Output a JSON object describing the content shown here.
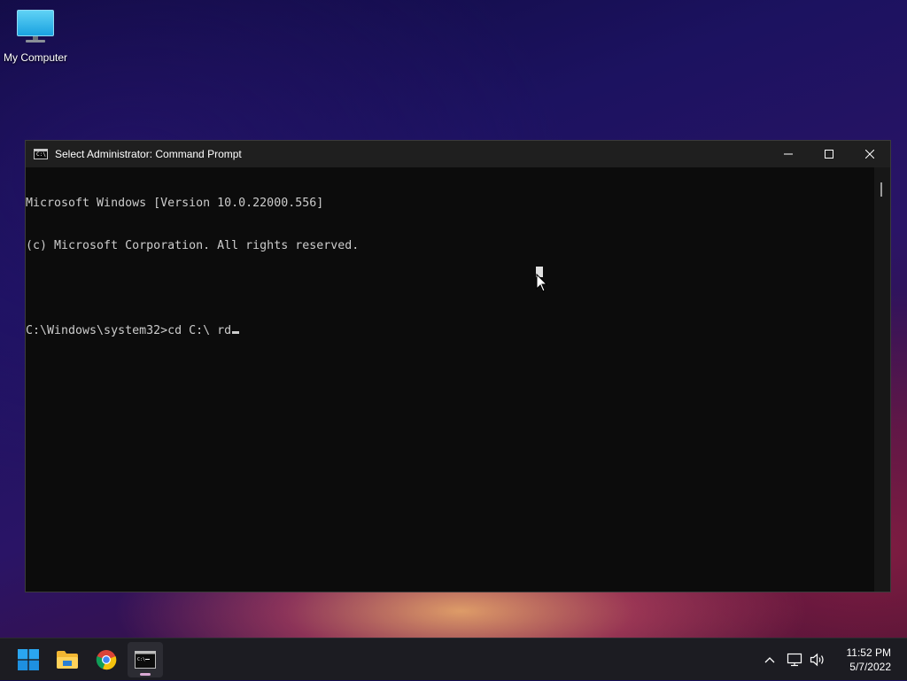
{
  "desktop": {
    "icons": [
      {
        "label": "My Computer",
        "icon": "monitor-icon"
      }
    ]
  },
  "window": {
    "title": "Select Administrator: Command Prompt",
    "icon": "cmd-icon",
    "controls": {
      "minimize": "minimize-icon",
      "maximize": "maximize-icon",
      "close": "close-icon"
    },
    "console_lines": [
      "Microsoft Windows [Version 10.0.22000.556]",
      "(c) Microsoft Corporation. All rights reserved.",
      "",
      "C:\\Windows\\system32>cd C:\\ rd"
    ],
    "colors": {
      "background": "#0c0c0c",
      "text": "#cccccc",
      "titlebar": "#1f1f1f"
    }
  },
  "taskbar": {
    "pinned": [
      {
        "name": "start",
        "icon": "windows-logo-icon"
      },
      {
        "name": "file-explorer",
        "icon": "folder-icon"
      },
      {
        "name": "chrome",
        "icon": "chrome-icon"
      },
      {
        "name": "command-prompt",
        "icon": "cmd-icon",
        "active": true
      }
    ],
    "tray_icons": [
      "chevron-up-icon",
      "network-icon",
      "volume-icon"
    ],
    "clock": {
      "time": "11:52 PM",
      "date": "5/7/2022"
    }
  }
}
